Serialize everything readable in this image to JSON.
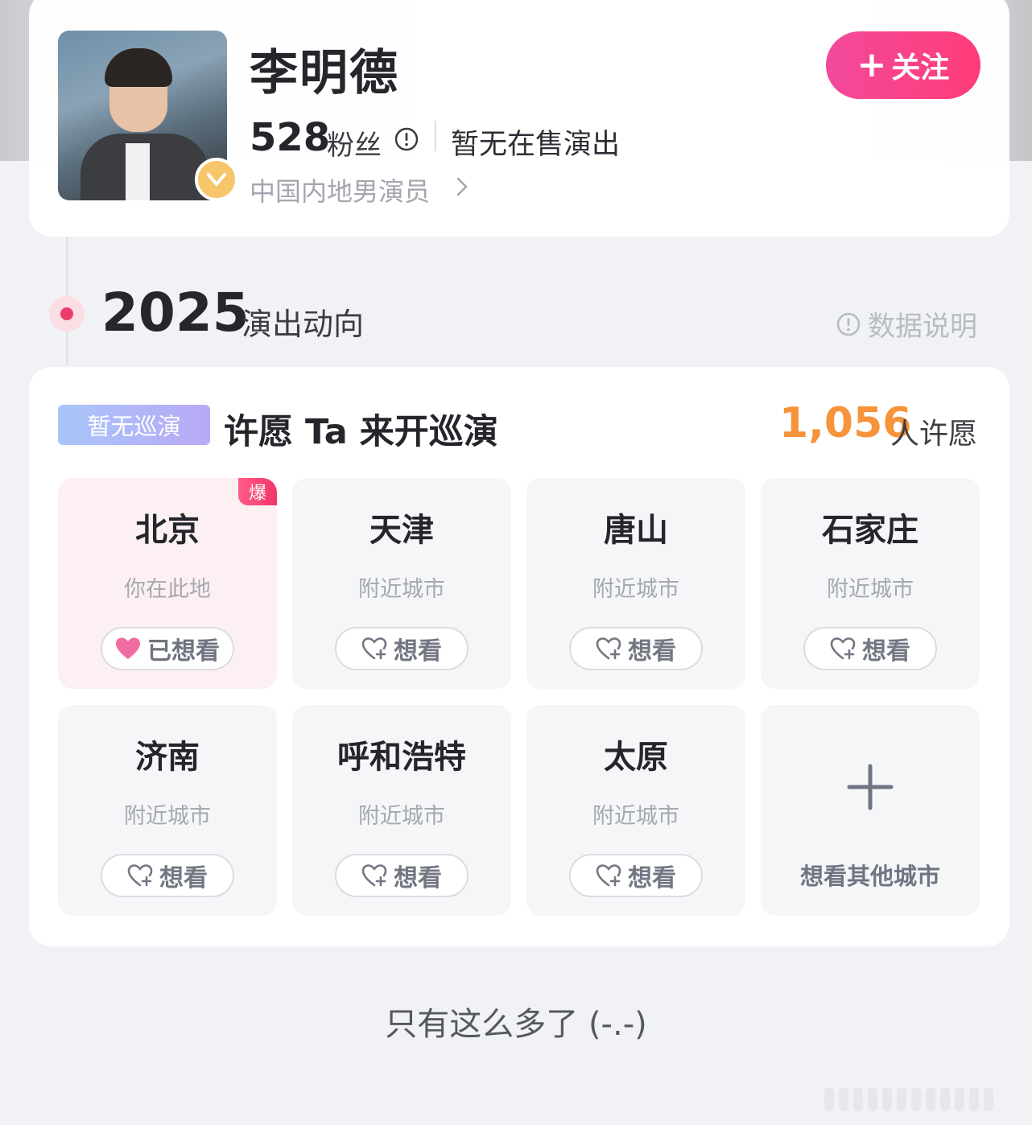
{
  "profile": {
    "name": "李明德",
    "fans_count": "528",
    "fans_label": "粉丝",
    "sale_status": "暂无在售演出",
    "occupation": "中国内地男演员",
    "follow_label": "关注"
  },
  "timeline": {
    "year": "2025",
    "subtitle": "演出动向",
    "data_explain": "数据说明"
  },
  "wish": {
    "tag": "暂无巡演",
    "title": "许愿 Ta 来开巡演",
    "count": "1,056",
    "count_label": "人许愿",
    "hot_badge": "爆",
    "cities": [
      {
        "name": "北京",
        "sub": "你在此地",
        "button": "已想看"
      },
      {
        "name": "天津",
        "sub": "附近城市",
        "button": "想看"
      },
      {
        "name": "唐山",
        "sub": "附近城市",
        "button": "想看"
      },
      {
        "name": "石家庄",
        "sub": "附近城市",
        "button": "想看"
      },
      {
        "name": "济南",
        "sub": "附近城市",
        "button": "想看"
      },
      {
        "name": "呼和浩特",
        "sub": "附近城市",
        "button": "想看"
      },
      {
        "name": "太原",
        "sub": "附近城市",
        "button": "想看"
      }
    ],
    "add_city_label": "想看其他城市"
  },
  "footer": {
    "note": "只有这么多了 (-.-)"
  },
  "colors": {
    "accent_pink": "#ff3c78",
    "wish_count": "#f7933a",
    "timeline_dot": "#ee3c6a"
  }
}
